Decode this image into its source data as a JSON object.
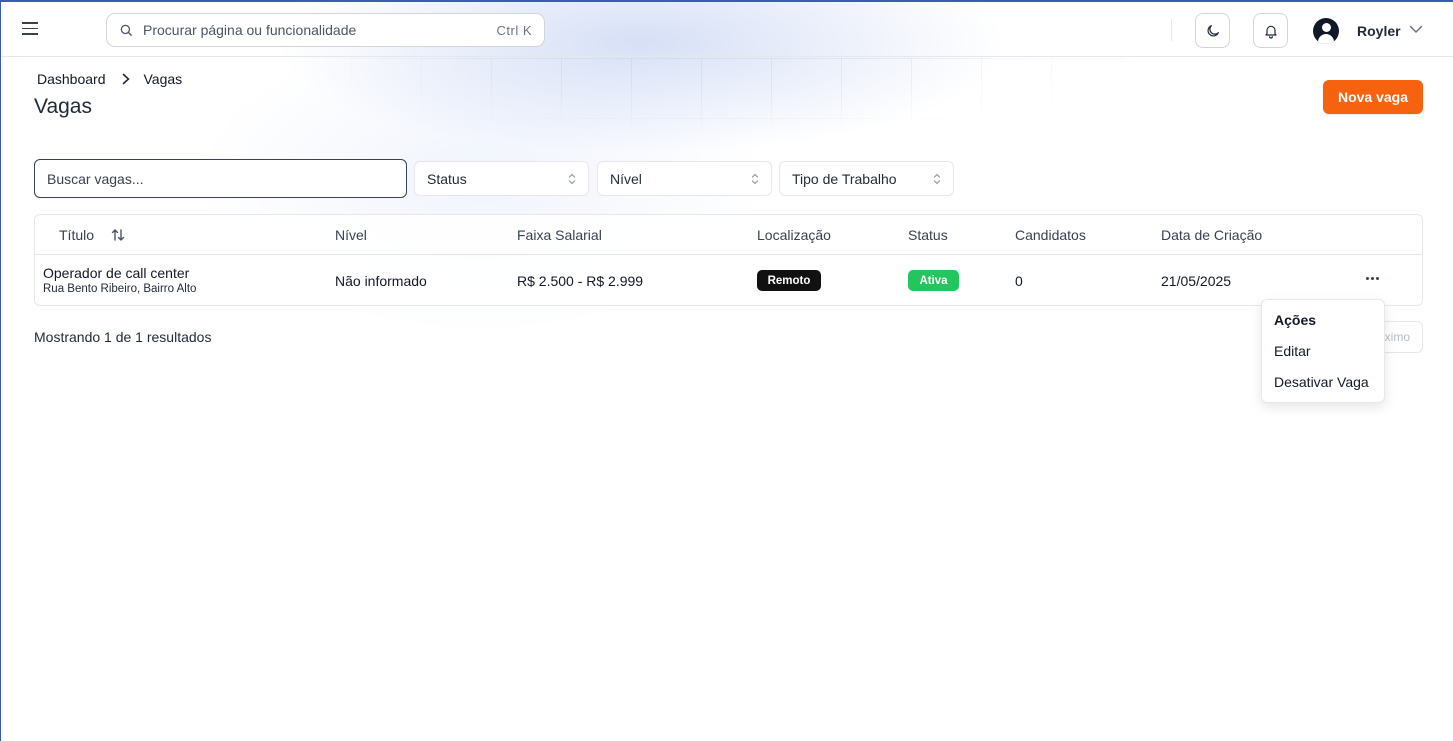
{
  "header": {
    "search_placeholder": "Procurar página ou funcionalidade",
    "search_shortcut": "Ctrl K",
    "user_name": "Royler"
  },
  "breadcrumb": {
    "items": [
      "Dashboard",
      "Vagas"
    ]
  },
  "page": {
    "title": "Vagas",
    "new_button": "Nova vaga"
  },
  "filters": {
    "search_placeholder": "Buscar vagas...",
    "selects": [
      "Status",
      "Nível",
      "Tipo de Trabalho"
    ]
  },
  "table": {
    "columns": [
      "Título",
      "Nível",
      "Faixa Salarial",
      "Localização",
      "Status",
      "Candidatos",
      "Data de Criação"
    ],
    "rows": [
      {
        "title": "Operador de call center",
        "address": "Rua Bento Ribeiro, Bairro Alto",
        "level": "Não informado",
        "salary": "R$ 2.500 - R$ 2.999",
        "location": "Remoto",
        "status": "Ativa",
        "candidates": "0",
        "created": "21/05/2025"
      }
    ]
  },
  "footer": {
    "results": "Mostrando 1 de 1 resultados",
    "next_label": "ximo"
  },
  "actions_menu": {
    "title": "Ações",
    "items": [
      "Editar",
      "Desativar Vaga"
    ]
  },
  "colors": {
    "accent": "#f7620f",
    "badge_remote": "#111111",
    "badge_active": "#22c55e"
  }
}
